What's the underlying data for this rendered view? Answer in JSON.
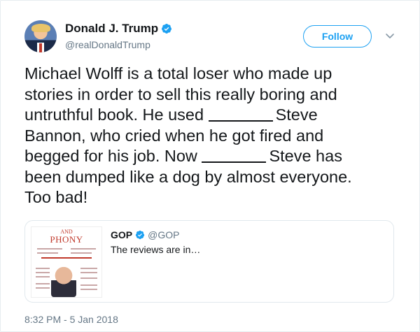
{
  "author": {
    "name": "Donald J. Trump",
    "handle": "@realDonaldTrump",
    "verified": true
  },
  "actions": {
    "follow_label": "Follow"
  },
  "tweet": {
    "lines": [
      "Michael Wolff is a total loser who made up",
      "stories in order to sell this really boring and",
      "untruthful book. He used",
      "Steve",
      "Bannon, who cried when he got fired and",
      "begged for his job. Now",
      "Steve has",
      "been dumped like a dog by almost everyone.",
      "Too bad!"
    ]
  },
  "quoted": {
    "name": "GOP",
    "handle": "@GOP",
    "verified": true,
    "text": "The reviews are in…",
    "book_and": "AND",
    "book_title": "PHONY"
  },
  "meta": {
    "timestamp": "8:32 PM - 5 Jan 2018"
  },
  "colors": {
    "accent": "#1da1f2",
    "text": "#14171a",
    "muted": "#657786",
    "border": "#e1e8ed"
  },
  "icons": {
    "verified": "verified-badge-icon",
    "caret": "chevron-down-icon"
  }
}
